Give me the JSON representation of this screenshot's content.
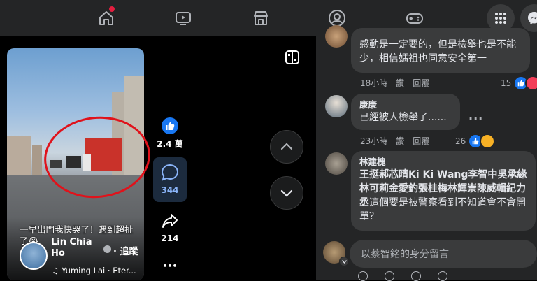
{
  "nav": {
    "icons": [
      "home-icon",
      "watch-icon",
      "marketplace-icon",
      "groups-icon",
      "gaming-icon"
    ],
    "right_icons": [
      "menu-grid-icon",
      "messenger-icon"
    ]
  },
  "reel": {
    "caption": "一早出門我快哭了！遇到超扯了😭",
    "user_name": "Lin Chia Ho",
    "follow_label": "· 追蹤",
    "audio": "♫ Yuming Lai · Eter...",
    "likes": "2.4 萬",
    "comments": "344",
    "shares": "214",
    "more": "•••"
  },
  "comments": [
    {
      "name": "",
      "text": "感動是一定要的，但是檢舉也是不能少，相信媽祖也同意安全第一",
      "time": "18小時",
      "like_label": "讚",
      "reply_label": "回覆",
      "reactions": "15",
      "reaction_icons": [
        "like",
        "love"
      ]
    },
    {
      "name": "康康",
      "text": "已經被人檢舉了......",
      "time": "23小時",
      "like_label": "讚",
      "reply_label": "回覆",
      "reactions": "26",
      "reaction_icons": [
        "like",
        "wow"
      ]
    },
    {
      "name": "林建槐",
      "tagged": "王挺郝芯晴Ki Ki Wang李智中吳承緣林可莉金愛釣張桂梅林輝崇陳威輯紀力丞",
      "text": "這個要是被警察看到不知道會不會開單？",
      "time": "",
      "like_label": "",
      "reply_label": ""
    }
  ],
  "composer": {
    "placeholder": "以蔡智銘的身分留言"
  },
  "colors": {
    "accent": "#1877f2",
    "panel_bg": "#242526",
    "bubble_bg": "#3a3b3c",
    "notification": "#e41e3f"
  }
}
